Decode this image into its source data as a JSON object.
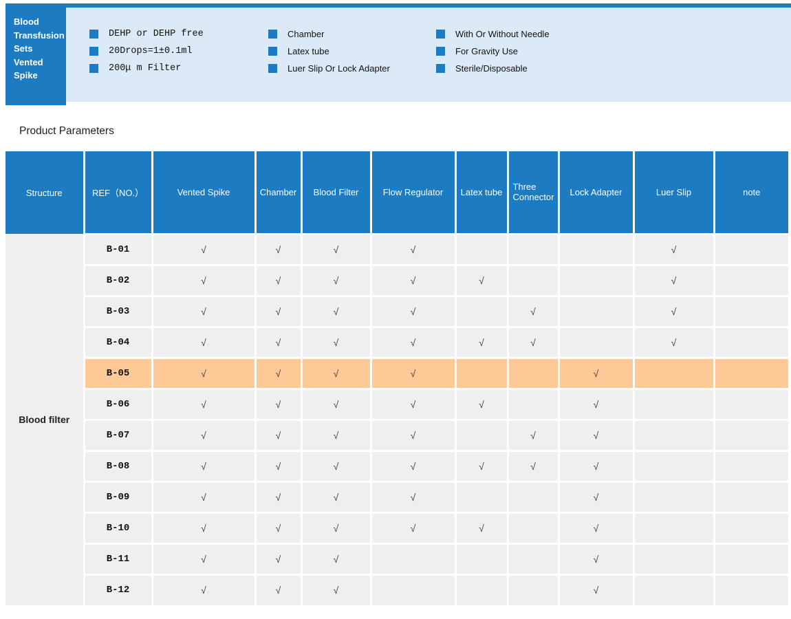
{
  "banner": {
    "title": "Blood\nTransfusion\nSets\nVented\nSpike",
    "features": {
      "col1": [
        "DEHP or DEHP free",
        "20Drops=1±0.1ml",
        "200μ m Filter"
      ],
      "col2": [
        "Chamber",
        "Latex tube",
        "Luer Slip Or Lock Adapter"
      ],
      "col3": [
        "With Or Without Needle",
        "For Gravity Use",
        "Sterile/Disposable"
      ]
    }
  },
  "section_title": "Product Parameters",
  "colors": {
    "brand_blue": "#1d7cc1",
    "light_blue": "#dce9f6",
    "cell_gray": "#efefef",
    "highlight_orange": "#fdca97"
  },
  "table": {
    "headers": [
      "Structure",
      "REF（NO.）",
      "Vented Spike",
      "Chamber",
      "Blood Filter",
      "Flow Regulator",
      "Latex tube",
      "Three Connector",
      "Lock Adapter",
      "Luer Slip",
      "note"
    ],
    "structure_label": "Blood filter",
    "check_glyph": "√",
    "rows": [
      {
        "ref": "B-01",
        "checks": [
          1,
          1,
          1,
          1,
          0,
          0,
          0,
          1,
          0
        ],
        "highlight": false
      },
      {
        "ref": "B-02",
        "checks": [
          1,
          1,
          1,
          1,
          1,
          0,
          0,
          1,
          0
        ],
        "highlight": false
      },
      {
        "ref": "B-03",
        "checks": [
          1,
          1,
          1,
          1,
          0,
          1,
          0,
          1,
          0
        ],
        "highlight": false
      },
      {
        "ref": "B-04",
        "checks": [
          1,
          1,
          1,
          1,
          1,
          1,
          0,
          1,
          0
        ],
        "highlight": false
      },
      {
        "ref": "B-05",
        "checks": [
          1,
          1,
          1,
          1,
          0,
          0,
          1,
          0,
          0
        ],
        "highlight": true
      },
      {
        "ref": "B-06",
        "checks": [
          1,
          1,
          1,
          1,
          1,
          0,
          1,
          0,
          0
        ],
        "highlight": false
      },
      {
        "ref": "B-07",
        "checks": [
          1,
          1,
          1,
          1,
          0,
          1,
          1,
          0,
          0
        ],
        "highlight": false
      },
      {
        "ref": "B-08",
        "checks": [
          1,
          1,
          1,
          1,
          1,
          1,
          1,
          0,
          0
        ],
        "highlight": false
      },
      {
        "ref": "B-09",
        "checks": [
          1,
          1,
          1,
          1,
          0,
          0,
          1,
          0,
          0
        ],
        "highlight": false
      },
      {
        "ref": "B-10",
        "checks": [
          1,
          1,
          1,
          1,
          1,
          0,
          1,
          0,
          0
        ],
        "highlight": false
      },
      {
        "ref": "B-11",
        "checks": [
          1,
          1,
          1,
          0,
          0,
          0,
          1,
          0,
          0
        ],
        "highlight": false
      },
      {
        "ref": "B-12",
        "checks": [
          1,
          1,
          1,
          0,
          0,
          0,
          1,
          0,
          0
        ],
        "highlight": false
      }
    ]
  }
}
